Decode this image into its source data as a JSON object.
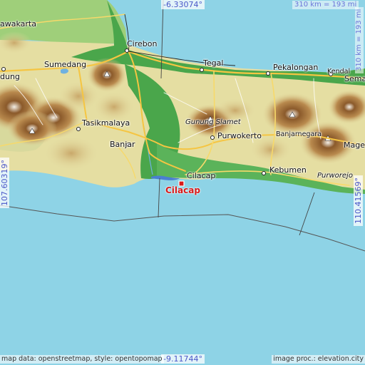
{
  "coords": {
    "top": "-6.33074°",
    "bottom": "-9.11744°",
    "left": "107.60319°",
    "right": "110.41569°"
  },
  "scale": {
    "top": "310 km = 193 mi",
    "right": "310 km = 193 mi"
  },
  "places": {
    "cirebon": "Cirebon",
    "tegal": "Tegal",
    "pekalongan": "Pekalongan",
    "kendal": "Kendal",
    "semarang": "Sema",
    "karawang": "awakarta",
    "sumedang": "Sumedang",
    "bandung": "dung",
    "tasikmalaya": "Tasikmalaya",
    "banjar": "Banjar",
    "gunung_slamet": "Gunung Slamet",
    "purwokerto": "Purwokerto",
    "banjarnegara": "Banjarnegara",
    "magelang": "Mage",
    "cilacap": "Cilacap",
    "kebumen": "Kebumen",
    "purworejo": "Purworejo",
    "highlight": "Cilacap"
  },
  "footer": {
    "left": "map data: openstreetmap, style: opentopomap",
    "right": "image proc.: elevation.city"
  },
  "colors": {
    "sea": "#8ed3e6",
    "lowland": "#43a447",
    "hills": "#e8e0a6",
    "mountains": "#a26a3a",
    "highlight": "#d81b1b",
    "coord_text": "#4a57c8"
  }
}
